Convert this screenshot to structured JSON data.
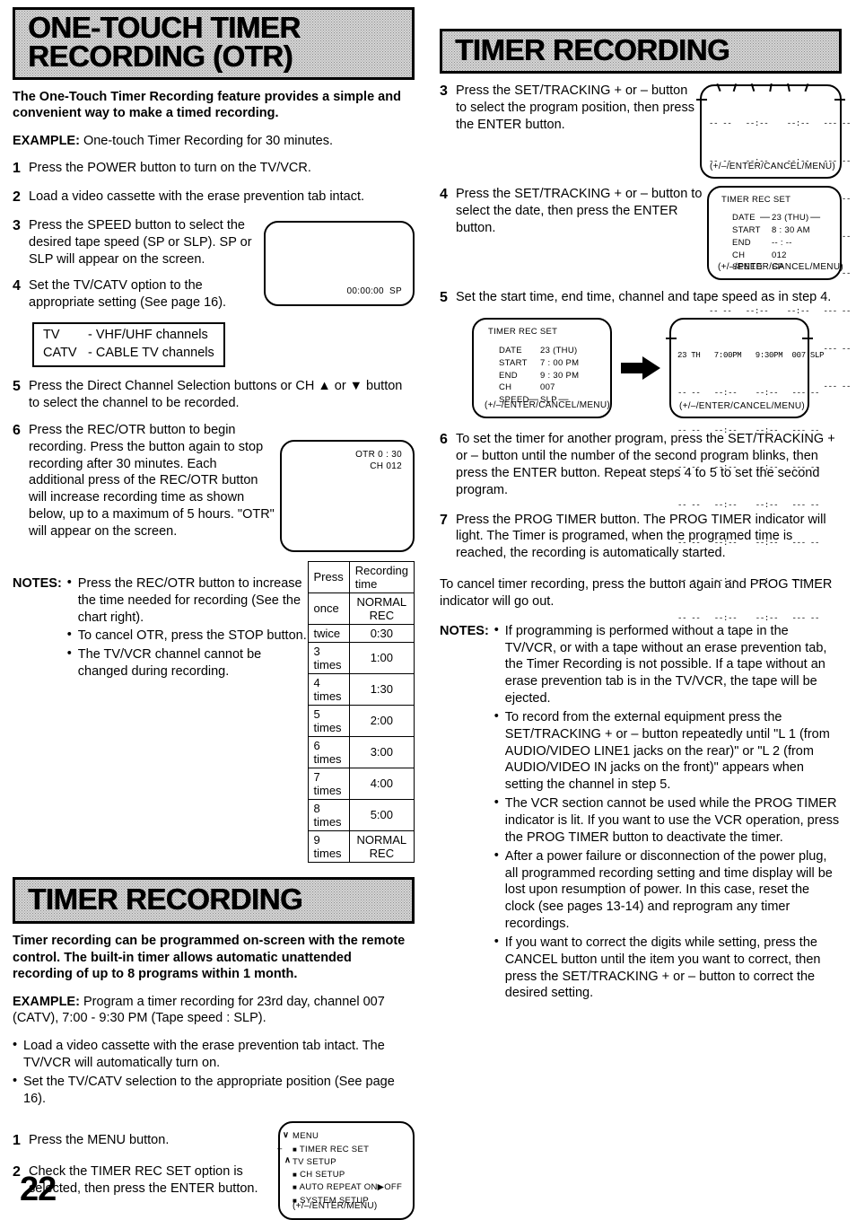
{
  "page": {
    "number": "22"
  },
  "left": {
    "header": "ONE-TOUCH TIMER RECORDING (OTR)",
    "intro": "The One-Touch Timer Recording feature provides a simple and convenient way to make a timed recording.",
    "example_label": "EXAMPLE:",
    "example_text": " One-touch Timer Recording for 30 minutes.",
    "steps": [
      {
        "num": "1",
        "text": "Press the POWER button to turn on the TV/VCR."
      },
      {
        "num": "2",
        "text": "Load a video cassette with the erase prevention tab intact."
      },
      {
        "num": "3",
        "text": "Press the SPEED button to select the desired tape speed (SP or SLP). SP or SLP will appear on the screen."
      },
      {
        "num": "4",
        "text": "Set the TV/CATV option to the appropriate setting (See page 16)."
      },
      {
        "num": "5",
        "text": "Press the Direct Channel Selection buttons or CH ▲ or ▼ button to select the channel to be recorded."
      },
      {
        "num": "6",
        "text": "Press the REC/OTR button  to begin recording. Press the button again to stop recording after 30 minutes. Each additional press of the REC/OTR button will increase recording time as shown below, up to a maximum of 5 hours. \"OTR\" will appear on the screen."
      }
    ],
    "screen_speed": {
      "counter": "00:00:00",
      "speed": "SP"
    },
    "tvcatv": [
      {
        "key": "TV",
        "value": "- VHF/UHF channels"
      },
      {
        "key": "CATV",
        "value": "- CABLE TV channels"
      }
    ],
    "screen_otr": {
      "line1": "OTR 0 : 30",
      "line2": "CH 012"
    },
    "notes_label": "NOTES:",
    "notes": [
      "Press the REC/OTR button to increase the time needed for recording (See the chart right).",
      "To cancel OTR, press the STOP button.",
      "The TV/VCR channel cannot be changed during recording."
    ],
    "rec_table": {
      "headers": [
        "Press",
        "Recording time"
      ],
      "rows": [
        [
          "once",
          "NORMAL REC"
        ],
        [
          "twice",
          "0:30"
        ],
        [
          "3 times",
          "1:00"
        ],
        [
          "4 times",
          "1:30"
        ],
        [
          "5 times",
          "2:00"
        ],
        [
          "6 times",
          "3:00"
        ],
        [
          "7 times",
          "4:00"
        ],
        [
          "8 times",
          "5:00"
        ],
        [
          "9 times",
          "NORMAL REC"
        ]
      ]
    },
    "timer_header": "TIMER RECORDING",
    "timer_intro": "Timer recording can be programmed on-screen with the remote control. The built-in timer allows automatic unattended recording of up to 8 programs within 1 month.",
    "timer_example_label": "EXAMPLE:",
    "timer_example_text": " Program a timer recording for 23rd day, channel 007 (CATV), 7:00 - 9:30 PM (Tape speed : SLP).",
    "timer_bullets": [
      "Load a video cassette with the erase prevention tab intact. The TV/VCR will automatically turn on.",
      "Set the TV/CATV selection to the appropriate position (See page 16)."
    ],
    "timer_steps": [
      {
        "num": "1",
        "text": "Press the MENU button."
      },
      {
        "num": "2",
        "text": "Check the TIMER REC SET option is selected, then press the ENTER button."
      }
    ],
    "menu_screen": {
      "title": "MENU",
      "items": [
        "TIMER REC SET",
        "TV SETUP",
        "CH SETUP",
        "AUTO REPEAT  ON▶OFF",
        "SYSTEM SETUP"
      ],
      "footer": "(+/–/ENTER/MENU)"
    }
  },
  "right": {
    "header": "TIMER RECORDING",
    "steps": [
      {
        "num": "3",
        "text": "Press the SET/TRACKING + or – button to select the program position, then press the ENTER button."
      },
      {
        "num": "4",
        "text": "Press the SET/TRACKING + or – button to select the date, then press the ENTER button."
      },
      {
        "num": "5",
        "text": "Set the start time, end time, channel and tape speed as in step 4."
      },
      {
        "num": "6",
        "text": "To set the timer for another program, press the SET/TRACKING + or – button until the number of the second program blinks, then press the ENTER button. Repeat steps 4 to 5 to set the second program."
      },
      {
        "num": "7",
        "text": "Press the PROG TIMER button. The PROG TIMER indicator will light. The Timer is programed, when the programed time is reached, the recording is automatically started."
      }
    ],
    "cancel_text": "To cancel timer recording, press the button again and PROG TIMER indicator will go out.",
    "list_screen_footer": "(+/–/ENTER/CANCEL/MENU)",
    "timer_rec_set_4": {
      "title": "TIMER REC SET",
      "rows": [
        {
          "label": "DATE",
          "value": "23 (THU)",
          "blink": true
        },
        {
          "label": "START",
          "value": "8 : 30 AM",
          "blink": false
        },
        {
          "label": "END",
          "value": "-- : --",
          "blink": false
        },
        {
          "label": "CH",
          "value": "012",
          "blink": false
        },
        {
          "label": "SPEED",
          "value": "SP",
          "blink": false
        }
      ],
      "footer": "(+/–/ENTER/CANCEL/MENU)"
    },
    "timer_rec_set_5": {
      "title": "TIMER REC SET",
      "rows": [
        {
          "label": "DATE",
          "value": "23 (THU)",
          "blink": false
        },
        {
          "label": "START",
          "value": "7 : 00 PM",
          "blink": false
        },
        {
          "label": "END",
          "value": "9 : 30 PM",
          "blink": false
        },
        {
          "label": "CH",
          "value": "007",
          "blink": false
        },
        {
          "label": "SPEED",
          "value": "SLP",
          "blink": true
        }
      ],
      "footer": "(+/–/ENTER/CANCEL/MENU)"
    },
    "program_list": {
      "first_row": "23 TH   7:00PM   9:30PM  007 SLP",
      "empty_row": "-- --   --:--    --:--   --- --",
      "footer": "(+/–/ENTER/CANCEL/MENU)"
    },
    "notes_label": "NOTES:",
    "notes": [
      "If programming is performed without a tape in the TV/VCR, or with a tape without an erase prevention tab, the Timer Recording is not possible. If a tape without an erase prevention tab is in the TV/VCR, the tape will be ejected.",
      "To record from the external equipment press the SET/TRACKING + or – button repeatedly until \"L 1 (from  AUDIO/VIDEO LINE1 jacks on the rear)\" or \"L 2 (from AUDIO/VIDEO IN jacks on the front)\" appears when setting the channel in step 5.",
      "The VCR section cannot be used while the PROG TIMER indicator is lit. If you want to use the VCR operation, press the PROG TIMER button to deactivate the timer.",
      "After a power failure or disconnection of the power plug, all programmed recording setting and time display will be lost upon resumption of power. In this case, reset the clock (see pages 13-14) and reprogram any timer recordings.",
      "If you want to correct the digits while setting, press the CANCEL button until the item you want to correct, then press the SET/TRACKING + or – button to correct the desired setting."
    ]
  }
}
